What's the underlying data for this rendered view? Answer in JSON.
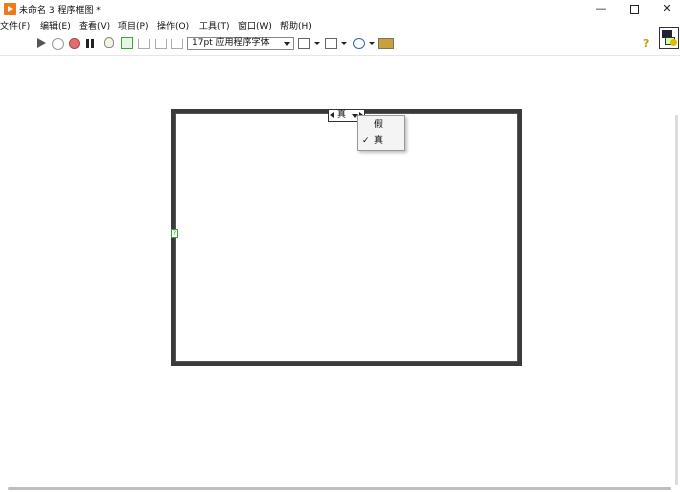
{
  "window": {
    "title": "未命名 3 程序框图 *",
    "min_glyph": "—",
    "close_glyph": "✕"
  },
  "menu": [
    "文件(F)",
    "编辑(E)",
    "查看(V)",
    "项目(P)",
    "操作(O)",
    "工具(T)",
    "窗口(W)",
    "帮助(H)"
  ],
  "toolbar": {
    "font_label": "17pt 应用程序字体",
    "help_glyph": "?"
  },
  "case_structure": {
    "selector_value": "真",
    "terminal_glyph": "?"
  },
  "selector_menu": {
    "options": [
      {
        "label": "假",
        "checked": false
      },
      {
        "label": "真",
        "checked": true
      }
    ],
    "check_glyph": "✓"
  },
  "colors": {
    "app_icon": "#f07a16",
    "terminal_green": "#33aa33",
    "abort_red": "#e06e6e"
  }
}
